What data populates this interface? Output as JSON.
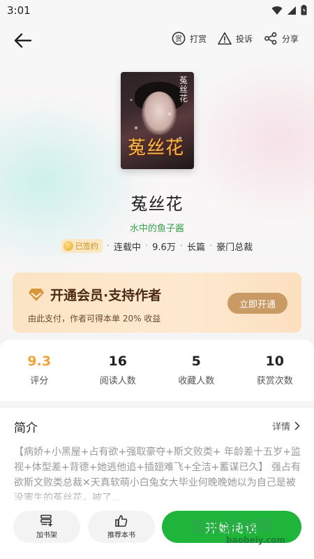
{
  "status_bar": {
    "time": "3:01"
  },
  "nav": {
    "reward_label": "打赏",
    "reward_icon_text": "赏",
    "report_label": "投诉",
    "share_label": "分享"
  },
  "book": {
    "cover_vertical_title": "菟丝花",
    "cover_title": "菟丝花",
    "title": "菟丝花",
    "author": "水中的鱼子酱",
    "signed_label": "已签约",
    "status": "连载中",
    "word_count": "9.6万",
    "length": "长篇",
    "genre": "豪门总裁"
  },
  "vip": {
    "title": "开通会员·支持作者",
    "subtitle": "由此支付，作者可得本单 20% 收益",
    "button": "立即开通"
  },
  "stats": [
    {
      "value": "9.3",
      "label": "评分"
    },
    {
      "value": "16",
      "label": "阅读人数"
    },
    {
      "value": "5",
      "label": "收藏人数"
    },
    {
      "value": "10",
      "label": "获赏次数"
    }
  ],
  "intro": {
    "title": "简介",
    "more": "详情",
    "text": "【病娇+小黑屋+占有欲+强取豪夺+斯文败类+ 年龄差十五岁+监视+体型差+背德+她逃他追+插翅难飞+全洁+蓄谋已久】 强占有欲斯文败类总裁✕天真软萌小白兔女大毕业何晚晚她以为自己是被没害生的菟丝花，被了..."
  },
  "bottom": {
    "shelf_label": "加书架",
    "recommend_label": "推荐本书",
    "read_label": "开始阅读"
  },
  "watermark": {
    "text": "宝贝游戏网",
    "url": "baobeiy.com"
  },
  "colors": {
    "accent_green": "#1fb53b",
    "author_green": "#3aa24e",
    "rating_orange": "#f0a233",
    "vip_button": "#c99a63"
  }
}
